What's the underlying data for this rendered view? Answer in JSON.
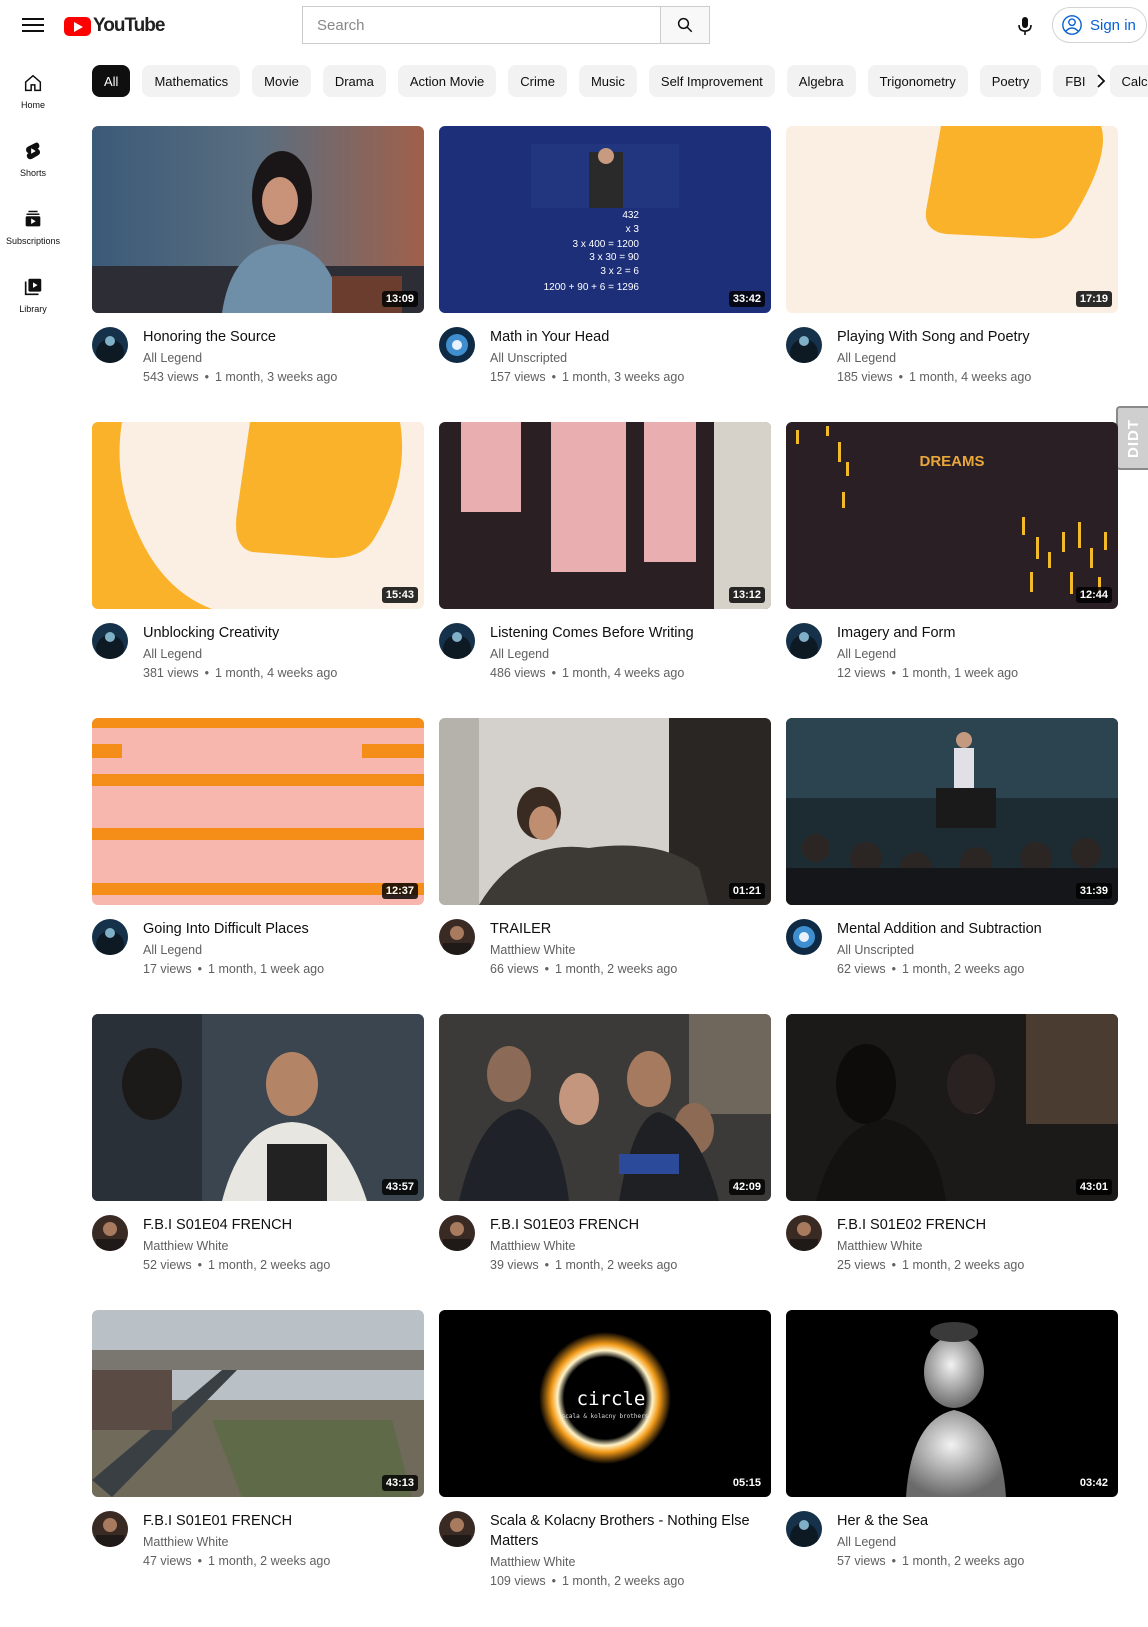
{
  "header": {
    "logo_text": "YouTube",
    "search_placeholder": "Search",
    "sign_in_label": "Sign in"
  },
  "sidebar": {
    "items": [
      {
        "label": "Home",
        "icon": "home-icon"
      },
      {
        "label": "Shorts",
        "icon": "shorts-icon"
      },
      {
        "label": "Subscriptions",
        "icon": "subscriptions-icon"
      },
      {
        "label": "Library",
        "icon": "library-icon"
      }
    ]
  },
  "chips": [
    "All",
    "Mathematics",
    "Movie",
    "Drama",
    "Action Movie",
    "Crime",
    "Music",
    "Self Improvement",
    "Algebra",
    "Trigonometry",
    "Poetry",
    "FBI",
    "Calculus"
  ],
  "floating_tab": "DIDT",
  "videos": [
    {
      "title": "Honoring the Source",
      "channel": "All Legend",
      "views": "543 views",
      "age": "1 month, 3 weeks ago",
      "duration": "13:09"
    },
    {
      "title": "Math in Your Head",
      "channel": "All Unscripted",
      "views": "157 views",
      "age": "1 month, 3 weeks ago",
      "duration": "33:42"
    },
    {
      "title": "Playing With Song and Poetry",
      "channel": "All Legend",
      "views": "185 views",
      "age": "1 month, 4 weeks ago",
      "duration": "17:19"
    },
    {
      "title": "Unblocking Creativity",
      "channel": "All Legend",
      "views": "381 views",
      "age": "1 month, 4 weeks ago",
      "duration": "15:43"
    },
    {
      "title": "Listening Comes Before Writing",
      "channel": "All Legend",
      "views": "486 views",
      "age": "1 month, 4 weeks ago",
      "duration": "13:12"
    },
    {
      "title": "Imagery and Form",
      "channel": "All Legend",
      "views": "12 views",
      "age": "1 month, 1 week ago",
      "duration": "12:44"
    },
    {
      "title": "Going Into Difficult Places",
      "channel": "All Legend",
      "views": "17 views",
      "age": "1 month, 1 week ago",
      "duration": "12:37"
    },
    {
      "title": "TRAILER",
      "channel": "Matthiew White",
      "views": "66 views",
      "age": "1 month, 2 weeks ago",
      "duration": "01:21"
    },
    {
      "title": "Mental Addition and Subtraction",
      "channel": "All Unscripted",
      "views": "62 views",
      "age": "1 month, 2 weeks ago",
      "duration": "31:39"
    },
    {
      "title": "F.B.I S01E04 FRENCH",
      "channel": "Matthiew White",
      "views": "52 views",
      "age": "1 month, 2 weeks ago",
      "duration": "43:57"
    },
    {
      "title": "F.B.I S01E03 FRENCH",
      "channel": "Matthiew White",
      "views": "39 views",
      "age": "1 month, 2 weeks ago",
      "duration": "42:09"
    },
    {
      "title": "F.B.I S01E02 FRENCH",
      "channel": "Matthiew White",
      "views": "25 views",
      "age": "1 month, 2 weeks ago",
      "duration": "43:01"
    },
    {
      "title": "F.B.I S01E01 FRENCH",
      "channel": "Matthiew White",
      "views": "47 views",
      "age": "1 month, 2 weeks ago",
      "duration": "43:13"
    },
    {
      "title": "Scala & Kolacny Brothers - Nothing Else Matters",
      "channel": "Matthiew White",
      "views": "109 views",
      "age": "1 month, 2 weeks ago",
      "duration": "05:15"
    },
    {
      "title": "Her & the Sea",
      "channel": "All Legend",
      "views": "57 views",
      "age": "1 month, 2 weeks ago",
      "duration": "03:42"
    }
  ],
  "thumbnail_text": {
    "math_lines": [
      "432",
      "x 3",
      "3 x 400 = 1200",
      "3 x 30 = 90",
      "3 x 2 = 6",
      "1200 + 90 + 6 = 1296"
    ],
    "dreams": "DREAMS",
    "circle": "circle",
    "circle_sub": "scala & kolacny brothers"
  },
  "colors": {
    "brand_red": "#ff0000",
    "link_blue": "#065fd4",
    "chip_bg": "#f2f2f2",
    "secondary_text": "#606060"
  }
}
